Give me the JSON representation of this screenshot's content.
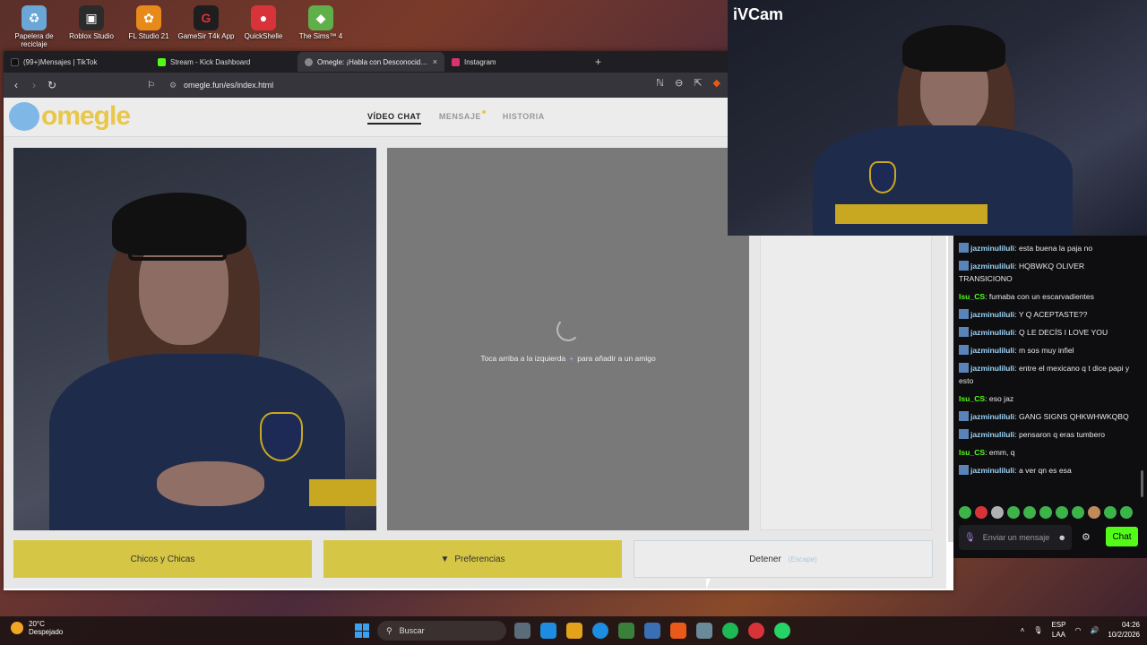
{
  "desktop": {
    "icons": [
      {
        "label": "Papelera de reciclaje",
        "color": "#6aa7d6"
      },
      {
        "label": "Roblox Studio",
        "color": "#2b2b2b"
      },
      {
        "label": "FL Studio 21",
        "color": "#e88a1a"
      },
      {
        "label": "GameSir T4k App",
        "color": "#1e1e1e"
      },
      {
        "label": "QuickShelle",
        "color": "#d9333a"
      },
      {
        "label": "The Sims™ 4",
        "color": "#5fb04a"
      }
    ]
  },
  "browser": {
    "tabs": [
      {
        "label": "(99+)Mensajes | TikTok",
        "color": "#111111"
      },
      {
        "label": "Stream - Kick Dashboard",
        "color": "#53fc18"
      },
      {
        "label": "Omegle: ¡Habla con Desconocidos!",
        "color": "#888888",
        "active": true,
        "close": "×"
      },
      {
        "label": "Instagram",
        "color": "#d9336e"
      }
    ],
    "new_tab": "+",
    "url": "omegle.fun/es/index.html"
  },
  "site": {
    "logo": "omegle",
    "nav": {
      "video_chat": "VÍDEO CHAT",
      "message": "MENSAJE",
      "history": "HISTORIA"
    },
    "hint_before": "Toca arriba a la izquierda",
    "hint_plus": "+",
    "hint_after": "para añadir a un amigo",
    "buttons": {
      "gender": "Chicos y Chicas",
      "preferences": "Preferencias",
      "stop": "Detener",
      "stop_hint": "(Escape)"
    }
  },
  "ivcam": {
    "title": "iVCam"
  },
  "kick_chat": {
    "messages": [
      {
        "user": "jazminuliluli",
        "text": "esta buena la paja no",
        "type": "u1"
      },
      {
        "user": "jazminuliluli",
        "text": "HQBWKQ OLIVER TRANSICIONO",
        "type": "u1"
      },
      {
        "user": "Isu_CS",
        "text": "fumaba con un escarvadientes",
        "type": "u2"
      },
      {
        "user": "jazminuliluli",
        "text": "Y Q ACEPTASTE??",
        "type": "u1"
      },
      {
        "user": "jazminuliluli",
        "text": "Q LE DECÍS I LOVE YOU",
        "type": "u1"
      },
      {
        "user": "jazminuliluli",
        "text": "m sos muy infiel",
        "type": "u1"
      },
      {
        "user": "jazminuliluli",
        "text": "entre el mexicano q t dice papi y esto",
        "type": "u1"
      },
      {
        "user": "Isu_CS",
        "text": "eso jaz",
        "type": "u2"
      },
      {
        "user": "jazminuliluli",
        "text": "GANG SIGNS QHKWHWKQBQ",
        "type": "u1"
      },
      {
        "user": "jazminuliluli",
        "text": "pensaron q eras tumbero",
        "type": "u1"
      },
      {
        "user": "Isu_CS",
        "text": "emm, q",
        "type": "u2"
      },
      {
        "user": "jazminuliluli",
        "text": "a ver qn es esa",
        "type": "u1"
      }
    ],
    "input_placeholder": "Enviar un mensaje",
    "chat_button": "Chat"
  },
  "taskbar": {
    "weather_temp": "20°C",
    "weather_desc": "Despejado",
    "search": "Buscar",
    "lang_top": "ESP",
    "lang_bottom": "LAA",
    "time": "04:26",
    "date": "10/2/2026",
    "apps": [
      "#f0b429",
      "#5a6b7a",
      "#e3a21a",
      "#1c8de0",
      "#3a7f3a",
      "#3b6fb5",
      "#e8591a",
      "#6a8a9a",
      "#1db954",
      "#d9333a",
      "#25d366"
    ]
  }
}
